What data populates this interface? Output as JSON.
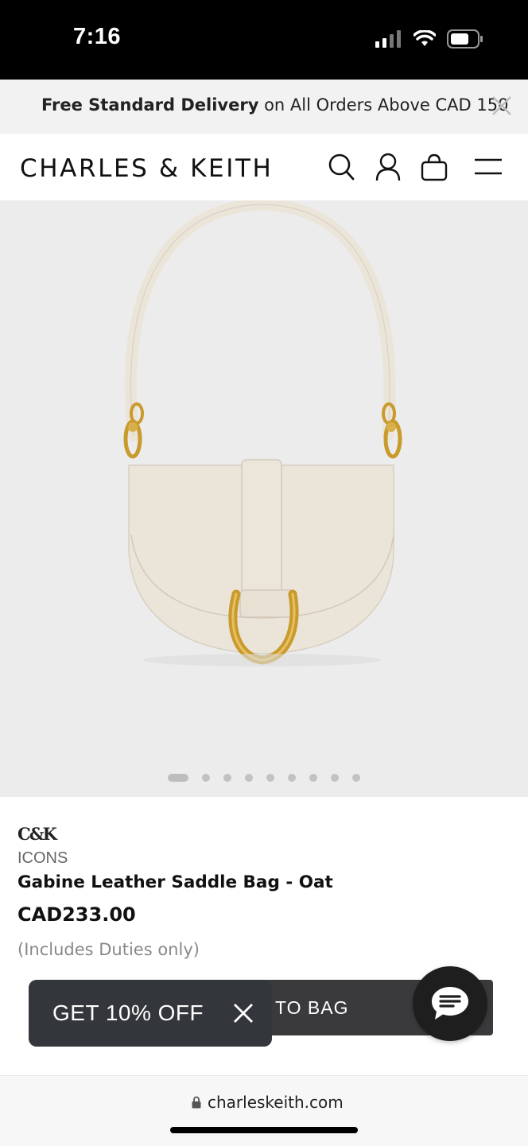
{
  "status": {
    "time": "7:16",
    "icons": [
      "signal-icon",
      "wifi-icon",
      "battery-icon"
    ]
  },
  "promo": {
    "bold": "Free Standard Delivery",
    "rest": " on All Orders Above CAD 150",
    "close_icon": "close-icon"
  },
  "header": {
    "logo": "CHARLES & KEITH",
    "icons": [
      "search-icon",
      "account-icon",
      "bag-icon",
      "menu-icon"
    ]
  },
  "gallery": {
    "image": "gabine-saddle-bag-oat",
    "total_images": 9,
    "active_index": 0
  },
  "product": {
    "brand_mark": "C&K",
    "collection": "ICONS",
    "name": "Gabine Leather Saddle Bag - Oat",
    "price": "CAD233.00",
    "duties_note": "(Includes Duties only)"
  },
  "actions": {
    "add_to_bag_visible": "TO BAG",
    "discount_label": "GET 10% OFF",
    "chat_icon": "chat-icon"
  },
  "browser": {
    "url": "charleskeith.com",
    "lock_icon": "lock-icon"
  },
  "colors": {
    "hero_bg": "#ececec",
    "bag": "#ebe4d8",
    "hardware": "#c99a2c",
    "button_dark": "#3a3a3c"
  }
}
